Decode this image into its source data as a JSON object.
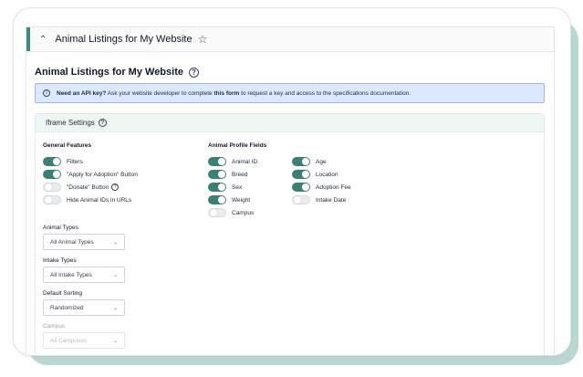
{
  "header": {
    "title": "Animal Listings for My Website",
    "collapse_icon": "chevron-up-icon",
    "favorite_icon": "star-outline-icon"
  },
  "page": {
    "title": "Animal Listings for My Website",
    "help_icon": "help-circle-icon"
  },
  "banner": {
    "icon": "info-icon",
    "bold_lead": "Need an API key?",
    "text_before": " Ask your website developer to complete ",
    "link_text": "this form",
    "text_after": " to request a key and access to the specifications documentation."
  },
  "iframe_settings": {
    "title": "Iframe Settings",
    "general_features": {
      "label": "General Features",
      "items": [
        {
          "label": "Filters",
          "on": true
        },
        {
          "label": "\"Apply for Adoption\" Button",
          "on": true
        },
        {
          "label": "\"Donate\" Button",
          "on": false
        },
        {
          "label": "Hide Animal IDs in URLs",
          "on": false
        }
      ]
    },
    "animal_profile_fields": {
      "label": "Animal Profile Fields",
      "col1": [
        {
          "label": "Animal ID",
          "on": true
        },
        {
          "label": "Breed",
          "on": true
        },
        {
          "label": "Sex",
          "on": true
        },
        {
          "label": "Weight",
          "on": true
        },
        {
          "label": "Campus",
          "on": false
        }
      ],
      "col2": [
        {
          "label": "Age",
          "on": true
        },
        {
          "label": "Location",
          "on": true
        },
        {
          "label": "Adoption Fee",
          "on": true
        },
        {
          "label": "Intake Date",
          "on": false
        }
      ]
    },
    "animal_types": {
      "label": "Animal Types",
      "value": "All Animal Types"
    },
    "intake_types": {
      "label": "Intake Types",
      "value": "All Intake Types"
    },
    "default_sorting": {
      "label": "Default Sorting",
      "value": "Randomized"
    },
    "campus": {
      "label": "Campus",
      "value": "All Campuses"
    }
  },
  "colors": {
    "accent": "#3d8a80",
    "toggle_on": "#3d7f75",
    "banner_bg": "#dce8ff",
    "backdrop": "#b9d8d4"
  }
}
